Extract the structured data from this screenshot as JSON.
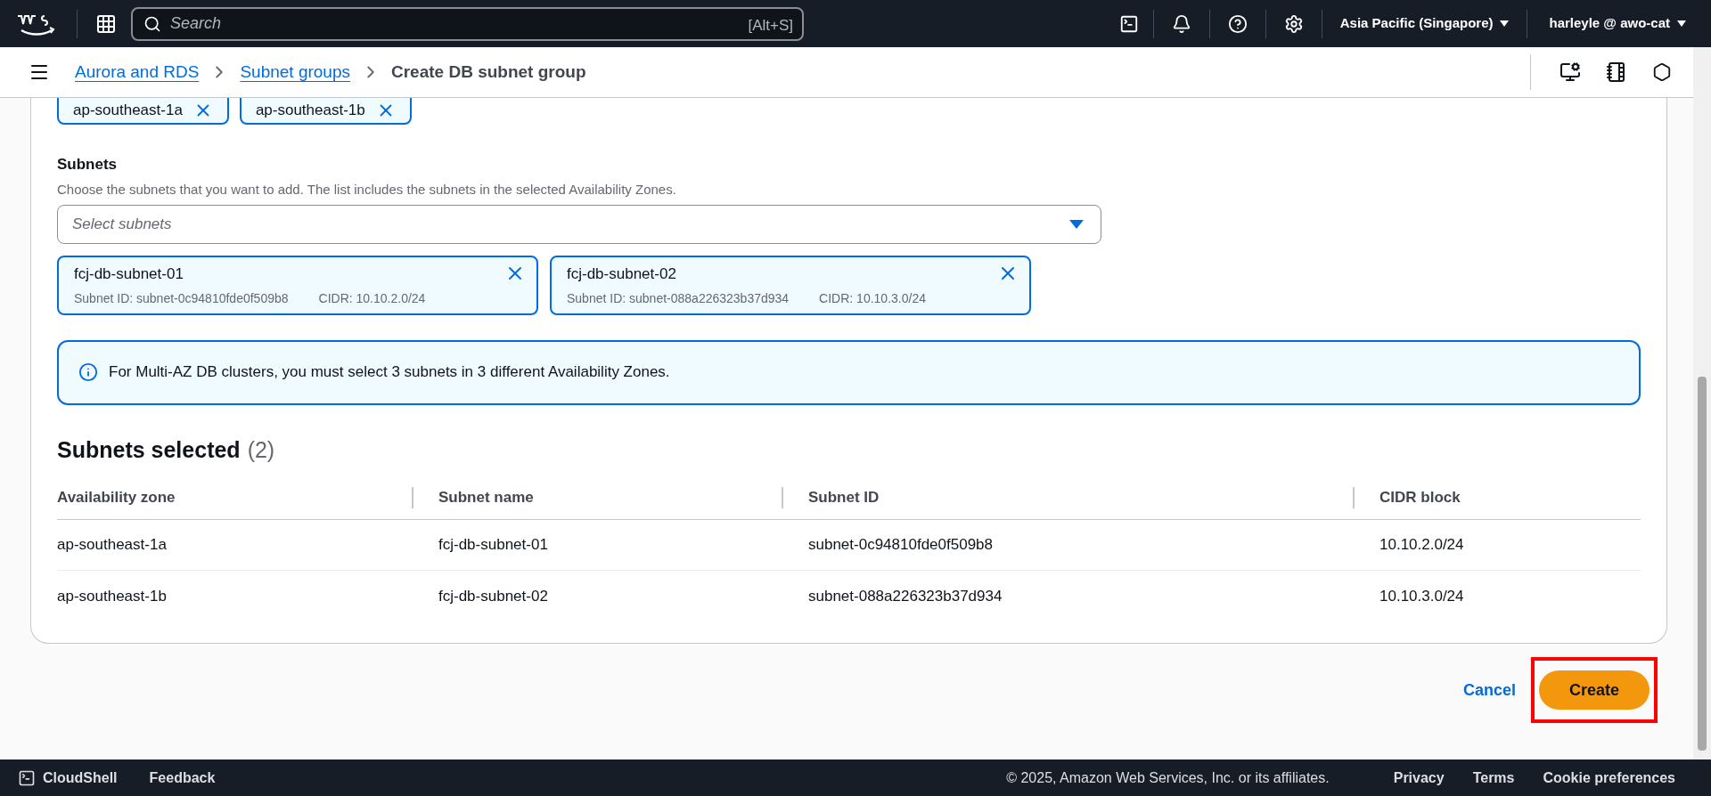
{
  "top_nav": {
    "search": {
      "placeholder": "Search",
      "shortcut": "[Alt+S]"
    },
    "region": "Asia Pacific (Singapore)",
    "account": "harleyle @ awo-cat"
  },
  "breadcrumbs": [
    {
      "label": "Aurora and RDS",
      "link": true
    },
    {
      "label": "Subnet groups",
      "link": true
    },
    {
      "label": "Create DB subnet group",
      "link": false
    }
  ],
  "availability_zone_tokens": [
    "ap-southeast-1a",
    "ap-southeast-1b"
  ],
  "subnets": {
    "label": "Subnets",
    "description": "Choose the subnets that you want to add. The list includes the subnets in the selected Availability Zones.",
    "placeholder": "Select subnets",
    "tokens": [
      {
        "name": "fcj-db-subnet-01",
        "id": "Subnet ID: subnet-0c94810fde0f509b8",
        "cidr": "CIDR: 10.10.2.0/24"
      },
      {
        "name": "fcj-db-subnet-02",
        "id": "Subnet ID: subnet-088a226323b37d934",
        "cidr": "CIDR: 10.10.3.0/24"
      }
    ]
  },
  "info_alert": "For Multi-AZ DB clusters, you must select 3 subnets in 3 different Availability Zones.",
  "table": {
    "title": "Subnets selected",
    "count": "(2)",
    "columns": [
      "Availability zone",
      "Subnet name",
      "Subnet ID",
      "CIDR block"
    ],
    "rows": [
      [
        "ap-southeast-1a",
        "fcj-db-subnet-01",
        "subnet-0c94810fde0f509b8",
        "10.10.2.0/24"
      ],
      [
        "ap-southeast-1b",
        "fcj-db-subnet-02",
        "subnet-088a226323b37d934",
        "10.10.3.0/24"
      ]
    ]
  },
  "actions": {
    "cancel": "Cancel",
    "create": "Create",
    "create_highlighted": true
  },
  "footer": {
    "cloudshell": "CloudShell",
    "feedback": "Feedback",
    "copyright": "© 2025, Amazon Web Services, Inc. or its affiliates.",
    "links": [
      "Privacy",
      "Terms",
      "Cookie preferences"
    ]
  }
}
